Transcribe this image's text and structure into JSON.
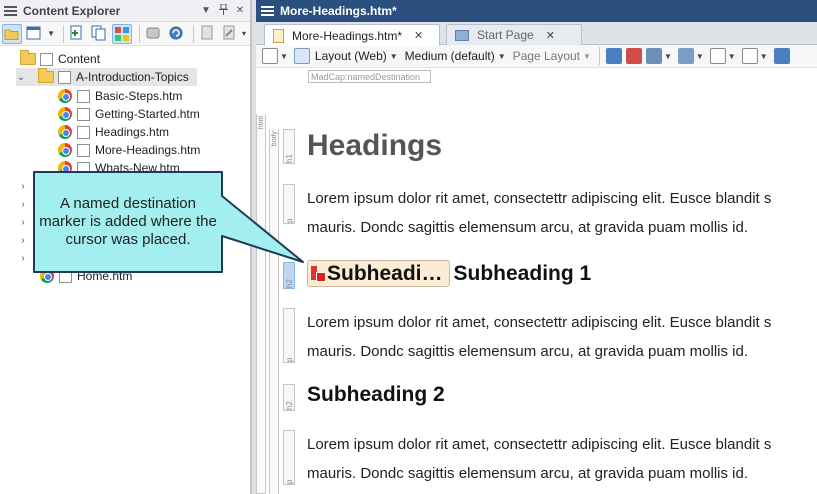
{
  "left_panel": {
    "title": "Content Explorer",
    "title_buttons": [
      "▼",
      "⊿",
      "✕"
    ],
    "tree": {
      "root": "Content",
      "folder": "A-Introduction-Topics",
      "files": [
        "Basic-Steps.htm",
        "Getting-Started.htm",
        "Headings.htm",
        "More-Headings.htm",
        "Whats-New.htm"
      ],
      "bottom_file": "Home.htm"
    }
  },
  "right_panel": {
    "title": "More-Headings.htm*",
    "tabs": [
      {
        "label": "More-Headings.htm*",
        "close": "✕"
      },
      {
        "label": "Start Page",
        "close": "✕"
      }
    ],
    "toolbar": {
      "layout": "Layout (Web)",
      "medium": "Medium (default)",
      "page_layout": "Page Layout"
    },
    "named_destination_label": "MadCap:namedDestination",
    "structure_bar": {
      "html": "html",
      "body": "body",
      "tags": [
        "h1",
        "p",
        "h2",
        "p",
        "h2",
        "p"
      ]
    },
    "document": {
      "h1": "Headings",
      "para_line1": "Lorem ipsum dolor rit amet, consectettr adipiscing elit. Eusce blandit s",
      "para_line2": "mauris. Dondc sagittis elemensum arcu, at gravida puam mollis id.",
      "marker_text": "Subheadi…",
      "subheading1": "Subheading 1",
      "subheading2": "Subheading 2"
    }
  },
  "callout": {
    "text": "A named destination marker is added where the cursor was placed.",
    "fill": "#a3eff0",
    "border": "#1e3a58"
  }
}
